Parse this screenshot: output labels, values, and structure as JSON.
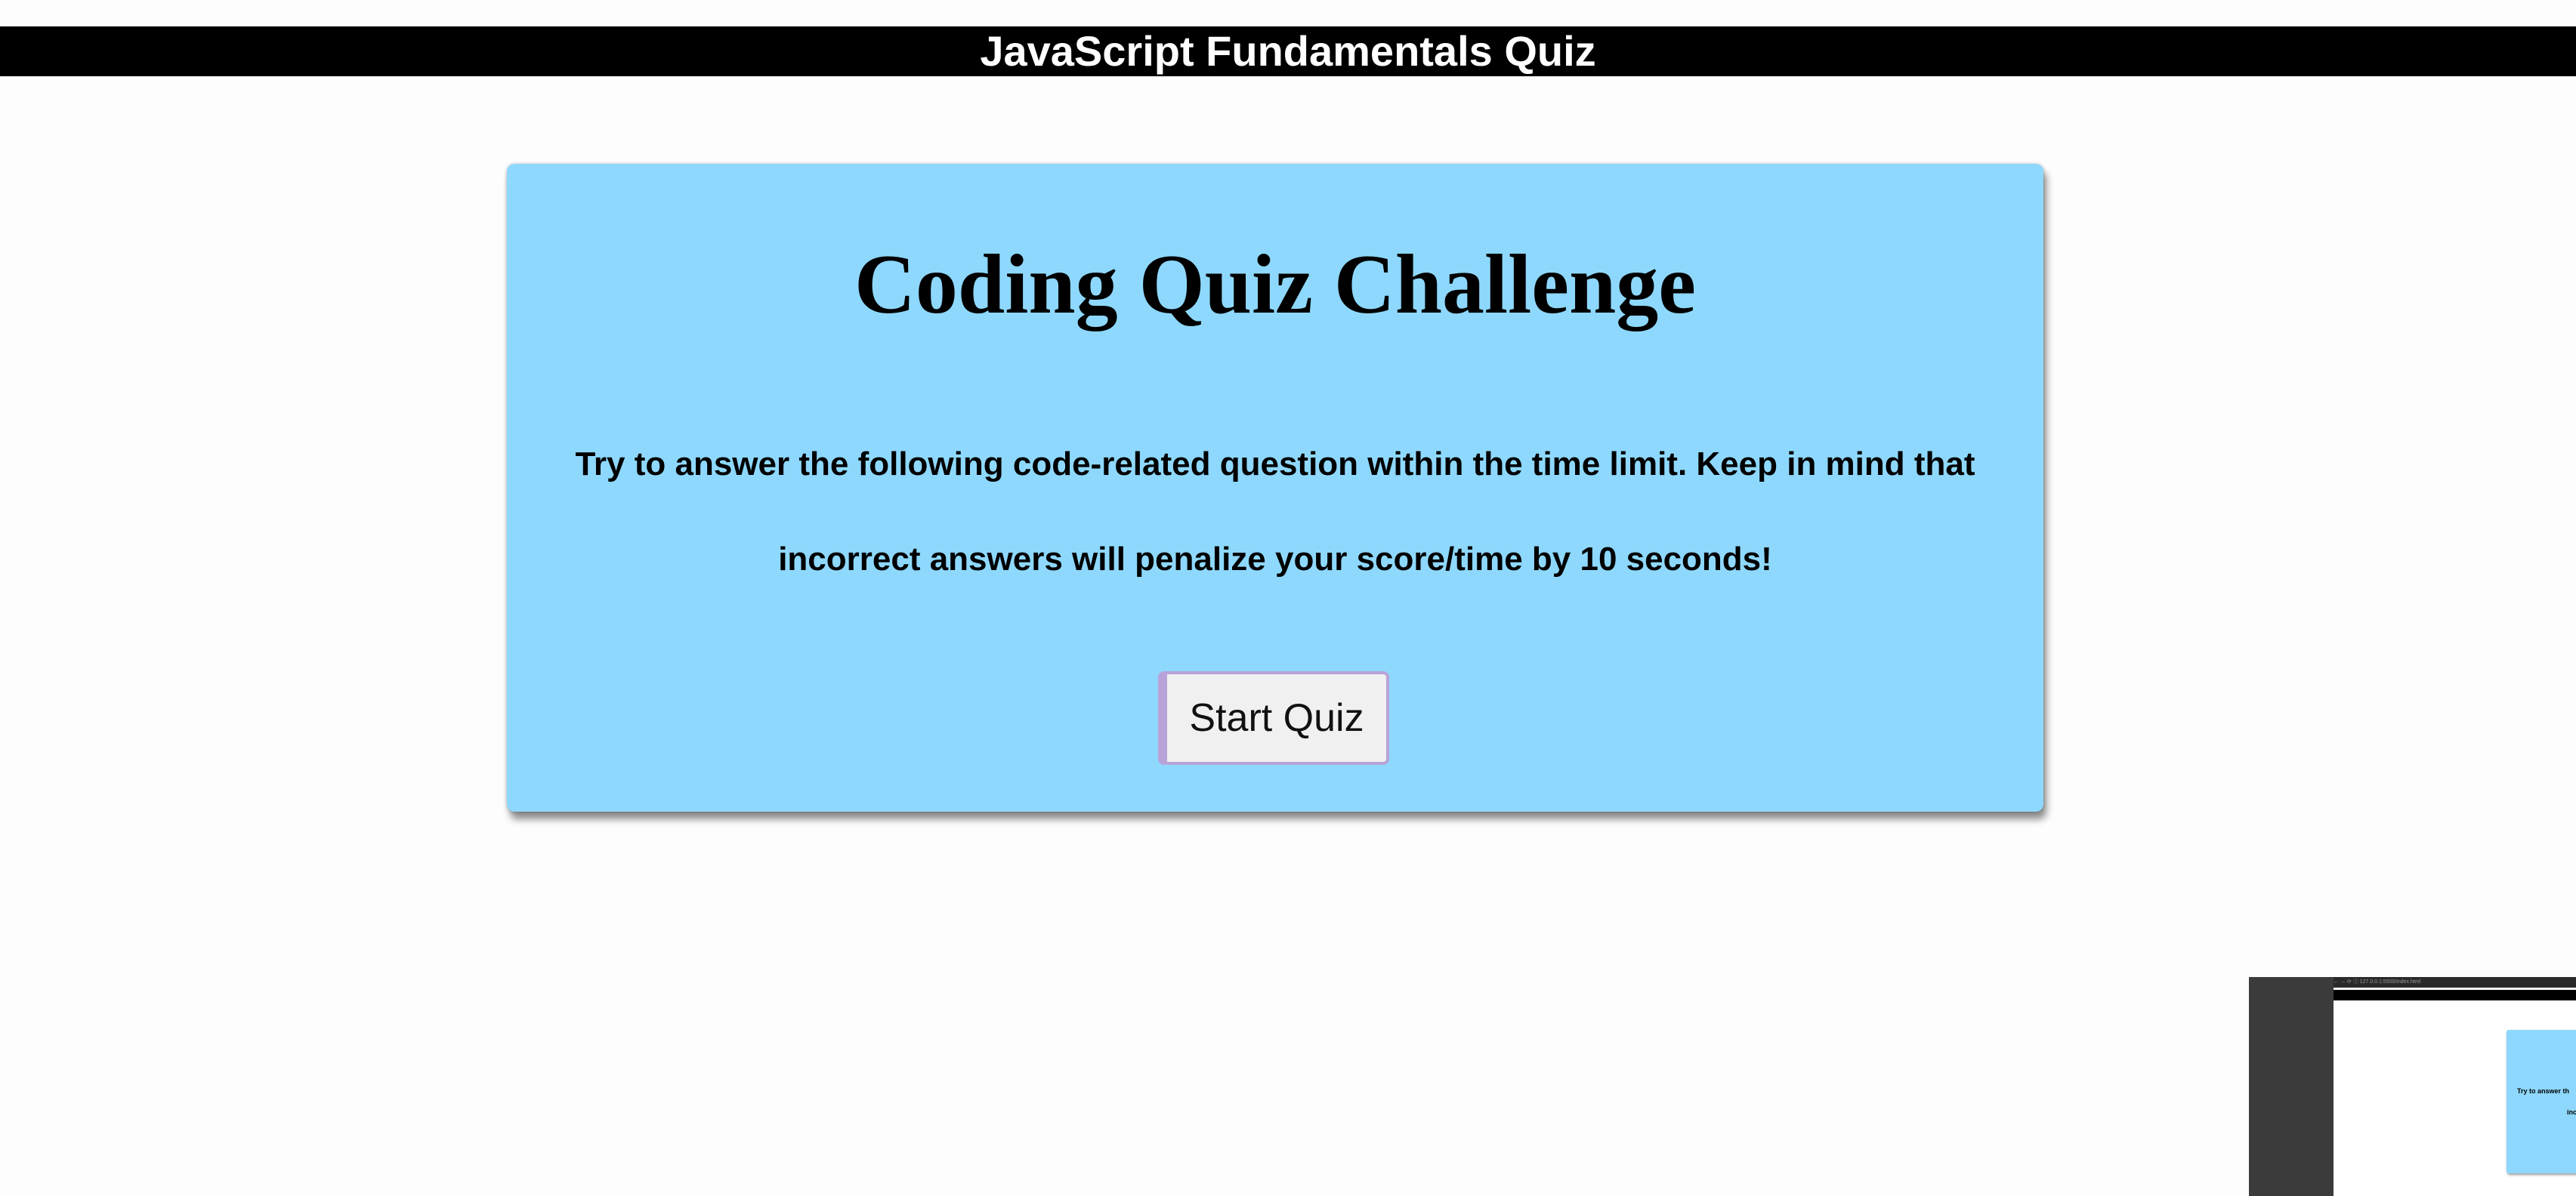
{
  "banner": {
    "title": "JavaScript Fundamentals Quiz"
  },
  "card": {
    "heading": "Coding Quiz Challenge",
    "instructions": "Try to answer the following code-related question within the time limit. Keep in mind that incorrect answers will penalize your score/time by 10 seconds!",
    "start_button_label": "Start Quiz"
  },
  "thumbnail": {
    "toolbar_text": "← → ⟳ ⓘ 127.0.0.1:5500/index.html",
    "line1": "Try to answer th",
    "line2": "inc"
  },
  "colors": {
    "banner_bg": "#000000",
    "card_bg": "#8ed8fd",
    "button_bg": "#f0f0f0",
    "button_border": "#b8a3d9",
    "page_bg": "#fdfdfd"
  }
}
